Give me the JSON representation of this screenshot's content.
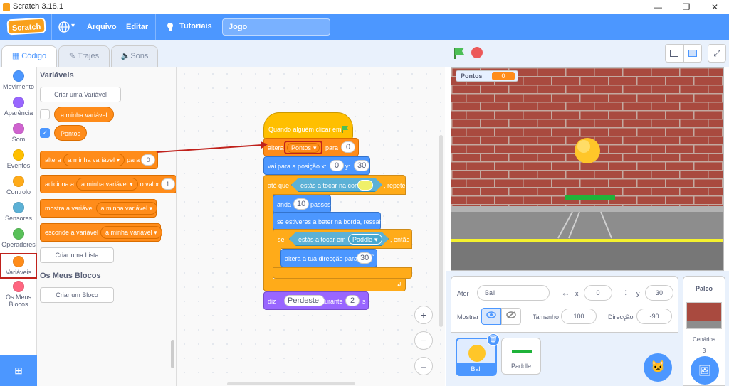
{
  "window": {
    "title": "Scratch 3.18.1",
    "min": "—",
    "max": "❐",
    "close": "✕"
  },
  "menubar": {
    "logo": "Scratch",
    "lang_caret": "▾",
    "file": "Arquivo",
    "edit": "Editar",
    "tutorials": "Tutoriais",
    "project_title": "Jogo"
  },
  "tabs": {
    "code": "Código",
    "costumes": "Trajes",
    "sounds": "Sons"
  },
  "categories": [
    {
      "label": "Movimento",
      "color": "#4c97ff"
    },
    {
      "label": "Aparência",
      "color": "#9966ff"
    },
    {
      "label": "Som",
      "color": "#cf63cf"
    },
    {
      "label": "Eventos",
      "color": "#ffbf00"
    },
    {
      "label": "Controlo",
      "color": "#ffab19"
    },
    {
      "label": "Sensores",
      "color": "#5cb1d6"
    },
    {
      "label": "Operadores",
      "color": "#59c059"
    },
    {
      "label": "Variáveis",
      "color": "#ff8c1a"
    },
    {
      "label": "Os Meus Blocos",
      "color": "#ff6680"
    }
  ],
  "palette": {
    "heading": "Variáveis",
    "make_variable": "Criar uma Variável",
    "var1": "a minha variável",
    "var2": "Pontos",
    "check_mark": "✓",
    "caret": "▾",
    "set_block": {
      "a": "altera",
      "var": "a minha variável",
      "b": "para",
      "val": "0"
    },
    "change_block": {
      "a": "adiciona a",
      "var": "a minha variável",
      "b": "o valor",
      "val": "1"
    },
    "show_block": {
      "a": "mostra a variável",
      "var": "a minha variável"
    },
    "hide_block": {
      "a": "esconde a variável",
      "var": "a minha variável"
    },
    "make_list": "Criar uma Lista",
    "my_blocks_heading": "Os Meus Blocos",
    "make_block": "Criar um Bloco"
  },
  "script": {
    "hat": "Quando alguém clicar em",
    "set_a": "altera",
    "set_var": "Pontos",
    "set_b": "para",
    "set_val": "0",
    "goto_a": "vai para a posição x:",
    "goto_x": "0",
    "goto_y_label": "y:",
    "goto_y": "30",
    "until_a": "até que",
    "until_touch": "estás a tocar na cor",
    "until_b": ", repete",
    "move_a": "anda",
    "move_val": "10",
    "move_b": "passos",
    "bounce": "se estiveres a bater na borda, ressalta",
    "if_a": "se",
    "if_touch": "estás a tocar em",
    "if_obj": "Paddle",
    "if_b": ", então",
    "turn_a": "altera a tua direcção para",
    "turn_val": "30",
    "turn_deg": "°",
    "loop_arrow": "↲",
    "say_a": "diz",
    "say_text": "Perdeste!",
    "say_b": "durante",
    "say_val": "2",
    "say_c": "s"
  },
  "zoom": {
    "in": "+",
    "out": "−",
    "reset": "="
  },
  "stage": {
    "monitor_label": "Pontos",
    "monitor_value": "0"
  },
  "sprite_info": {
    "actor_label": "Ator",
    "actor_name": "Ball",
    "x_label": "x",
    "x_val": "0",
    "y_label": "y",
    "y_val": "30",
    "show_label": "Mostrar",
    "size_label": "Tamanho",
    "size_val": "100",
    "dir_label": "Direcção",
    "dir_val": "-90"
  },
  "sprites": [
    {
      "name": "Ball"
    },
    {
      "name": "Paddle"
    }
  ],
  "stage_panel": {
    "title": "Palco",
    "backdrops_label": "Cenários",
    "backdrops_count": "3"
  }
}
